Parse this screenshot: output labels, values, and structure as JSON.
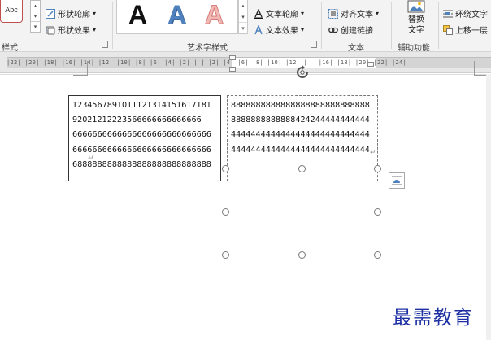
{
  "ribbon": {
    "style_sample": "Abc",
    "shape_outline": "形状轮廓",
    "shape_effects": "形状效果",
    "group_styles": "样式",
    "wordart_samples": [
      "A",
      "A",
      "A"
    ],
    "group_wordart": "艺术字样式",
    "text_outline": "文本轮廓",
    "text_effects": "文本效果",
    "align_text": "对齐文本",
    "create_link": "创建链接",
    "group_text": "文本",
    "alt_text_line1": "替换",
    "alt_text_line2": "文字",
    "group_accessibility": "辅助功能",
    "wrap_text": "环绕文字",
    "bring_forward": "上移一层",
    "dropdown_arrow": "▾",
    "accent_color": "#4f81bd"
  },
  "ruler": {
    "left_text": "|22| |20| |18| |16| |14| |12| |10| |8| |6| |4| |2| |",
    "middle_text": "| |2| |4| |6| |8| |10| |12| |",
    "right_text": "|16| |18| |20| |22| |24|"
  },
  "document": {
    "paragraph_mark": "↵",
    "textbox1_lines": [
      "1234567891011121314151617181",
      "92021212223566666666666666",
      "6666666666666666666666666666",
      "6666666666666666666666666666",
      "6888888888888888888888888888"
    ],
    "textbox2_lines": [
      "8888888888888888888888888888",
      "8888888888888424244444444444",
      "4444444444444444444444444444",
      "4444444444444444444444444444"
    ]
  },
  "watermark": "最需教育"
}
